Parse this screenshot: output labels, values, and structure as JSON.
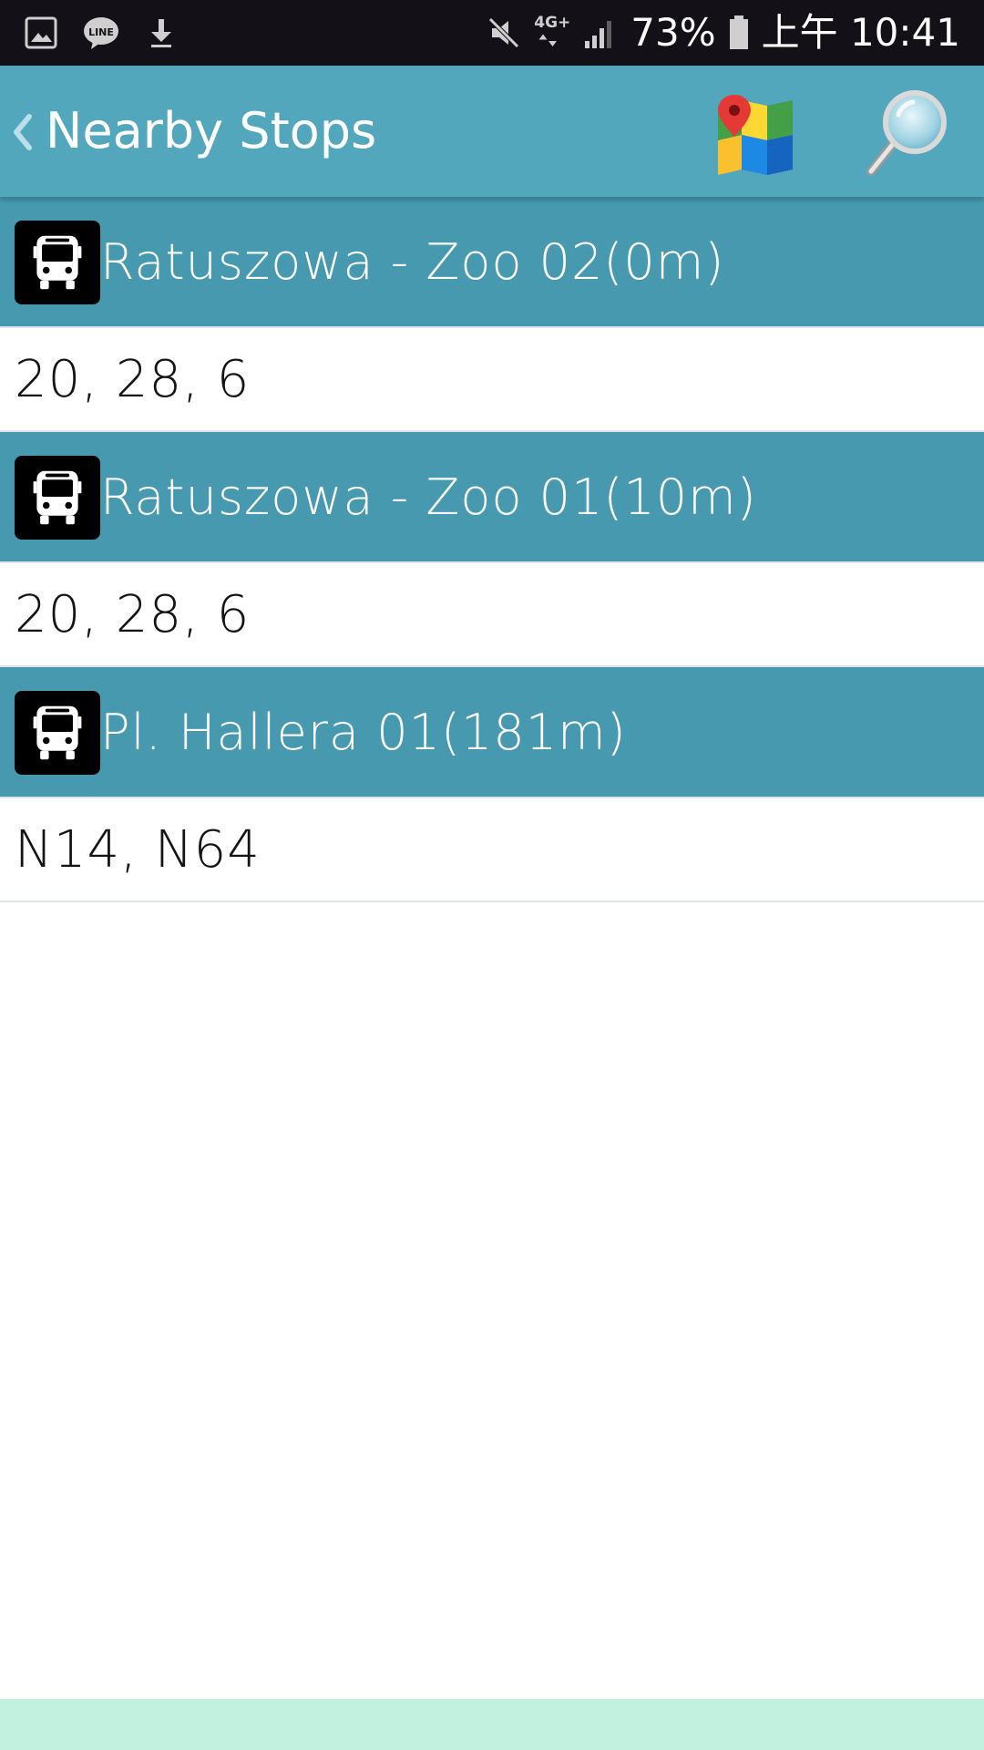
{
  "status_bar": {
    "battery": "73%",
    "time": "上午 10:41",
    "network": "4G+"
  },
  "app_bar": {
    "title": "Nearby Stops"
  },
  "stops": [
    {
      "name": "Ratuszowa - Zoo 02(0m)",
      "lines": "20, 28, 6"
    },
    {
      "name": "Ratuszowa - Zoo 01(10m)",
      "lines": "20, 28, 6"
    },
    {
      "name": "Pl. Hallera 01(181m)",
      "lines": "N14, N64"
    }
  ],
  "colors": {
    "status_bar": "#131117",
    "app_bar": "#53a7bd",
    "stop_header": "#4699af",
    "bottom_strip": "#c3f1df"
  },
  "icons": {
    "back": "chevron-left-icon",
    "map": "map-pin-icon",
    "search": "magnifier-icon",
    "stop": "bus-icon"
  }
}
